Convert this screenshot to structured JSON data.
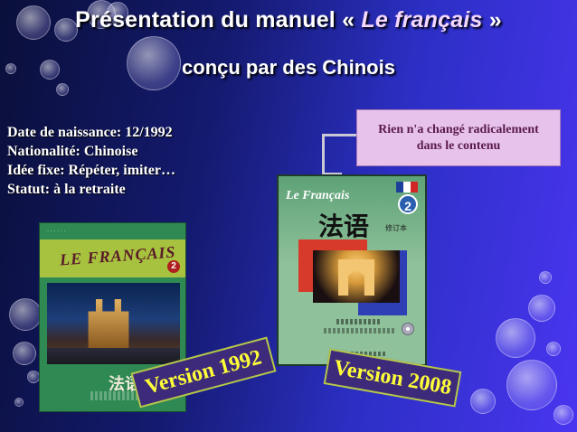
{
  "title": {
    "line1_prefix": "Présentation du manuel « ",
    "line1_emphasis": "Le français",
    "line1_suffix": " »",
    "line2": "conçu par des Chinois"
  },
  "facts": [
    "Date de naissance: 12/1992",
    "Nationalité: Chinoise",
    "Idée fixe: Répéter, imiter…",
    "Statut: à la retraite"
  ],
  "callout": {
    "text": "Rien n'a changé radicalement dans le contenu"
  },
  "book_1992": {
    "cover_title": "LE FRANÇAIS",
    "volume": "2",
    "chinese_title": "法语",
    "version_label": "Version 1992"
  },
  "book_2008": {
    "cover_title": "Le Français",
    "volume": "2",
    "chinese_title": "法语",
    "chinese_subtitle": "修订本",
    "version_label": "Version 2008"
  },
  "colors": {
    "callout_bg": "#e7c3ec",
    "version_text": "#ffff38",
    "version_bg": "#3d2a7a"
  }
}
